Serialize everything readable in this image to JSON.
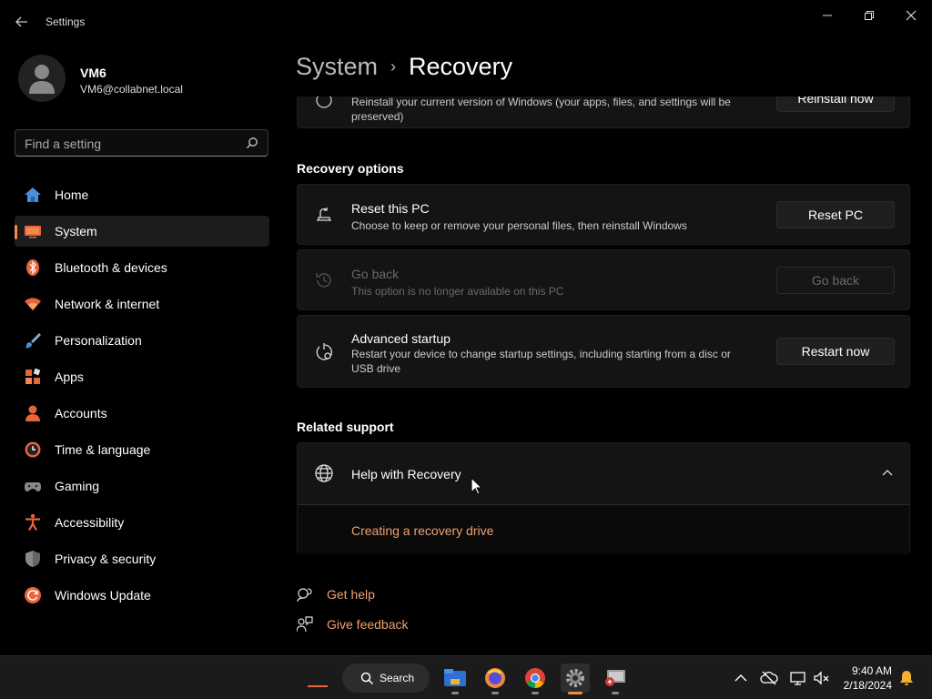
{
  "window": {
    "title": "Settings"
  },
  "user": {
    "name": "VM6",
    "email": "VM6@collabnet.local"
  },
  "search": {
    "placeholder": "Find a setting"
  },
  "sidebar": {
    "items": [
      {
        "label": "Home",
        "icon": "home-icon"
      },
      {
        "label": "System",
        "icon": "system-icon",
        "active": true
      },
      {
        "label": "Bluetooth & devices",
        "icon": "bluetooth-icon"
      },
      {
        "label": "Network & internet",
        "icon": "network-icon"
      },
      {
        "label": "Personalization",
        "icon": "brush-icon"
      },
      {
        "label": "Apps",
        "icon": "apps-icon"
      },
      {
        "label": "Accounts",
        "icon": "accounts-icon"
      },
      {
        "label": "Time & language",
        "icon": "time-icon"
      },
      {
        "label": "Gaming",
        "icon": "gaming-icon"
      },
      {
        "label": "Accessibility",
        "icon": "accessibility-icon"
      },
      {
        "label": "Privacy & security",
        "icon": "shield-icon"
      },
      {
        "label": "Windows Update",
        "icon": "update-icon"
      }
    ]
  },
  "breadcrumb": {
    "parent": "System",
    "separator": "›",
    "current": "Recovery"
  },
  "top_card": {
    "desc": "Reinstall your current version of Windows (your apps, files, and settings will be preserved)",
    "button": "Reinstall now"
  },
  "recovery_options": {
    "heading": "Recovery options",
    "items": [
      {
        "title": "Reset this PC",
        "desc": "Choose to keep or remove your personal files, then reinstall Windows",
        "button": "Reset PC",
        "enabled": true
      },
      {
        "title": "Go back",
        "desc": "This option is no longer available on this PC",
        "button": "Go back",
        "enabled": false
      },
      {
        "title": "Advanced startup",
        "desc": "Restart your device to change startup settings, including starting from a disc or USB drive",
        "button": "Restart now",
        "enabled": true
      }
    ]
  },
  "related_support": {
    "heading": "Related support",
    "help_title": "Help with Recovery",
    "link": "Creating a recovery drive"
  },
  "footer_links": {
    "get_help": "Get help",
    "give_feedback": "Give feedback"
  },
  "taskbar": {
    "search_label": "Search",
    "time": "9:40 AM",
    "date": "2/18/2024"
  },
  "colors": {
    "accent": "#f08a4b",
    "link": "#f0a070",
    "background": "#000000",
    "card": "#141414"
  }
}
